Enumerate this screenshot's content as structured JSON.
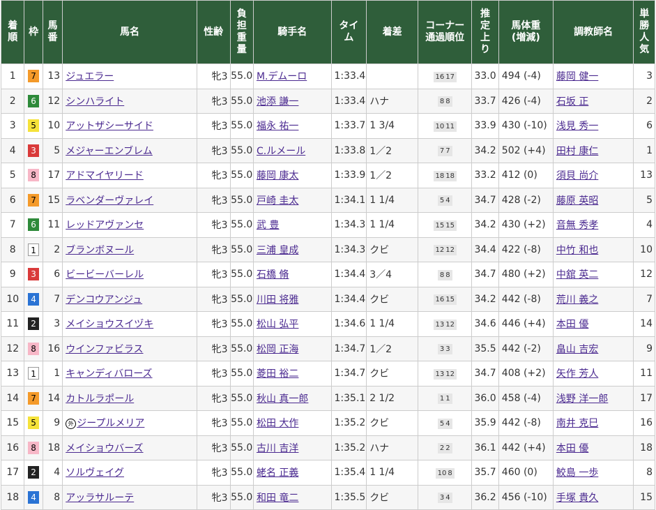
{
  "headers": {
    "rank": [
      "着",
      "順"
    ],
    "waku": [
      "枠"
    ],
    "umaban": [
      "馬",
      "番"
    ],
    "name": [
      "馬名"
    ],
    "sexage": [
      "性齢"
    ],
    "weight": [
      "負",
      "担",
      "重",
      "量"
    ],
    "jockey": [
      "騎手名"
    ],
    "time": [
      "タイ",
      "ム"
    ],
    "margin": [
      "着差"
    ],
    "corner": [
      "コーナー",
      "通過順位"
    ],
    "last3f": [
      "推",
      "定",
      "上",
      "り"
    ],
    "body": [
      "馬体重",
      "(増減)"
    ],
    "trainer": [
      "調教師名"
    ],
    "pop": [
      "単",
      "勝",
      "人",
      "気"
    ]
  },
  "rows": [
    {
      "rank": "1",
      "waku": "7",
      "umaban": "13",
      "mark": "",
      "name": "ジュエラー",
      "sexage": "牝3",
      "weight": "55.0",
      "jockey": "M.デムーロ",
      "time": "1:33.4",
      "margin": "",
      "corner": [
        "16",
        "17"
      ],
      "last3f": "33.0",
      "body": "494 (-4)",
      "trainer": "藤岡 健一",
      "pop": "3"
    },
    {
      "rank": "2",
      "waku": "6",
      "umaban": "12",
      "mark": "",
      "name": "シンハライト",
      "sexage": "牝3",
      "weight": "55.0",
      "jockey": "池添 謙一",
      "time": "1:33.4",
      "margin": "ハナ",
      "corner": [
        "8",
        "8"
      ],
      "last3f": "33.7",
      "body": "426 (-4)",
      "trainer": "石坂 正",
      "pop": "2"
    },
    {
      "rank": "3",
      "waku": "5",
      "umaban": "10",
      "mark": "",
      "name": "アットザシーサイド",
      "sexage": "牝3",
      "weight": "55.0",
      "jockey": "福永 祐一",
      "time": "1:33.7",
      "margin": "1 3/4",
      "corner": [
        "10",
        "11"
      ],
      "last3f": "33.9",
      "body": "430 (-10)",
      "trainer": "浅見 秀一",
      "pop": "6"
    },
    {
      "rank": "4",
      "waku": "3",
      "umaban": "5",
      "mark": "",
      "name": "メジャーエンブレム",
      "sexage": "牝3",
      "weight": "55.0",
      "jockey": "C.ルメール",
      "time": "1:33.8",
      "margin": "1／2",
      "corner": [
        "7",
        "7"
      ],
      "last3f": "34.2",
      "body": "502 (+4)",
      "trainer": "田村 康仁",
      "pop": "1"
    },
    {
      "rank": "5",
      "waku": "8",
      "umaban": "17",
      "mark": "",
      "name": "アドマイヤリード",
      "sexage": "牝3",
      "weight": "55.0",
      "jockey": "藤岡 康太",
      "time": "1:33.9",
      "margin": "1／2",
      "corner": [
        "18",
        "18"
      ],
      "last3f": "33.2",
      "body": "412 (0)",
      "trainer": "須貝 尚介",
      "pop": "13"
    },
    {
      "rank": "6",
      "waku": "7",
      "umaban": "15",
      "mark": "",
      "name": "ラベンダーヴァレイ",
      "sexage": "牝3",
      "weight": "55.0",
      "jockey": "戸崎 圭太",
      "time": "1:34.1",
      "margin": "1 1/4",
      "corner": [
        "5",
        "4"
      ],
      "last3f": "34.7",
      "body": "428 (-2)",
      "trainer": "藤原 英昭",
      "pop": "5"
    },
    {
      "rank": "7",
      "waku": "6",
      "umaban": "11",
      "mark": "",
      "name": "レッドアヴァンセ",
      "sexage": "牝3",
      "weight": "55.0",
      "jockey": "武 豊",
      "time": "1:34.3",
      "margin": "1 1/4",
      "corner": [
        "15",
        "15"
      ],
      "last3f": "34.2",
      "body": "430 (+2)",
      "trainer": "音無 秀孝",
      "pop": "4"
    },
    {
      "rank": "8",
      "waku": "1",
      "umaban": "2",
      "mark": "",
      "name": "ブランボヌール",
      "sexage": "牝3",
      "weight": "55.0",
      "jockey": "三浦 皇成",
      "time": "1:34.3",
      "margin": "クビ",
      "corner": [
        "12",
        "12"
      ],
      "last3f": "34.4",
      "body": "422 (-8)",
      "trainer": "中竹 和也",
      "pop": "10"
    },
    {
      "rank": "9",
      "waku": "3",
      "umaban": "6",
      "mark": "",
      "name": "ビービーバーレル",
      "sexage": "牝3",
      "weight": "55.0",
      "jockey": "石橋 脩",
      "time": "1:34.4",
      "margin": "3／4",
      "corner": [
        "8",
        "8"
      ],
      "last3f": "34.7",
      "body": "480 (+2)",
      "trainer": "中舘 英二",
      "pop": "12"
    },
    {
      "rank": "10",
      "waku": "4",
      "umaban": "7",
      "mark": "",
      "name": "デンコウアンジュ",
      "sexage": "牝3",
      "weight": "55.0",
      "jockey": "川田 将雅",
      "time": "1:34.4",
      "margin": "クビ",
      "corner": [
        "16",
        "15"
      ],
      "last3f": "34.2",
      "body": "442 (-8)",
      "trainer": "荒川 義之",
      "pop": "7"
    },
    {
      "rank": "11",
      "waku": "2",
      "umaban": "3",
      "mark": "",
      "name": "メイショウスイヅキ",
      "sexage": "牝3",
      "weight": "55.0",
      "jockey": "松山 弘平",
      "time": "1:34.6",
      "margin": "1 1/4",
      "corner": [
        "13",
        "12"
      ],
      "last3f": "34.6",
      "body": "446 (+4)",
      "trainer": "本田 優",
      "pop": "14"
    },
    {
      "rank": "12",
      "waku": "8",
      "umaban": "16",
      "mark": "",
      "name": "ウインファビラス",
      "sexage": "牝3",
      "weight": "55.0",
      "jockey": "松岡 正海",
      "time": "1:34.7",
      "margin": "1／2",
      "corner": [
        "3",
        "3"
      ],
      "last3f": "35.5",
      "body": "442 (-2)",
      "trainer": "畠山 吉宏",
      "pop": "9"
    },
    {
      "rank": "13",
      "waku": "1",
      "umaban": "1",
      "mark": "",
      "name": "キャンディバローズ",
      "sexage": "牝3",
      "weight": "55.0",
      "jockey": "菱田 裕二",
      "time": "1:34.7",
      "margin": "クビ",
      "corner": [
        "13",
        "12"
      ],
      "last3f": "34.7",
      "body": "408 (+2)",
      "trainer": "矢作 芳人",
      "pop": "11"
    },
    {
      "rank": "14",
      "waku": "7",
      "umaban": "14",
      "mark": "",
      "name": "カトルラポール",
      "sexage": "牝3",
      "weight": "55.0",
      "jockey": "秋山 真一郎",
      "time": "1:35.1",
      "margin": "2 1/2",
      "corner": [
        "1",
        "1"
      ],
      "last3f": "36.0",
      "body": "458 (-4)",
      "trainer": "浅野 洋一郎",
      "pop": "17"
    },
    {
      "rank": "15",
      "waku": "5",
      "umaban": "9",
      "mark": "外",
      "name": "ジープルメリア",
      "sexage": "牝3",
      "weight": "55.0",
      "jockey": "松田 大作",
      "time": "1:35.2",
      "margin": "クビ",
      "corner": [
        "5",
        "4"
      ],
      "last3f": "35.9",
      "body": "442 (-8)",
      "trainer": "南井 克巳",
      "pop": "16"
    },
    {
      "rank": "16",
      "waku": "8",
      "umaban": "18",
      "mark": "",
      "name": "メイショウバーズ",
      "sexage": "牝3",
      "weight": "55.0",
      "jockey": "古川 吉洋",
      "time": "1:35.2",
      "margin": "ハナ",
      "corner": [
        "2",
        "2"
      ],
      "last3f": "36.1",
      "body": "442 (+4)",
      "trainer": "本田 優",
      "pop": "18"
    },
    {
      "rank": "17",
      "waku": "2",
      "umaban": "4",
      "mark": "",
      "name": "ソルヴェイグ",
      "sexage": "牝3",
      "weight": "55.0",
      "jockey": "蛯名 正義",
      "time": "1:35.4",
      "margin": "1 1/4",
      "corner": [
        "10",
        "8"
      ],
      "last3f": "35.7",
      "body": "460 (0)",
      "trainer": "鮫島 一歩",
      "pop": "8"
    },
    {
      "rank": "18",
      "waku": "4",
      "umaban": "8",
      "mark": "",
      "name": "アッラサルーテ",
      "sexage": "牝3",
      "weight": "55.0",
      "jockey": "和田 竜二",
      "time": "1:35.5",
      "margin": "クビ",
      "corner": [
        "3",
        "4"
      ],
      "last3f": "36.2",
      "body": "456 (-10)",
      "trainer": "手塚 貴久",
      "pop": "15"
    }
  ]
}
